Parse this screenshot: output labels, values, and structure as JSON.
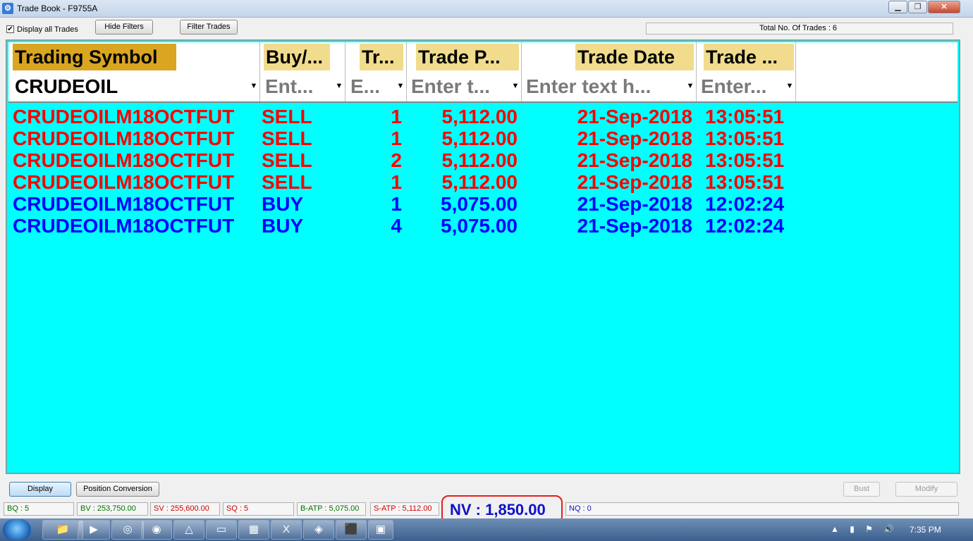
{
  "window": {
    "title": "Trade Book - F9755A",
    "minimize_glyph": "▁",
    "maximize_glyph": "❐",
    "close_glyph": "✕"
  },
  "toolbar": {
    "display_all_checked": true,
    "display_all_label": "Display all Trades",
    "hide_filters_label": "Hide Filters",
    "filter_trades_label": "Filter Trades",
    "total_trades_label": "Total No. Of Trades : 6"
  },
  "grid": {
    "background_color": "#00ffff",
    "columns": [
      {
        "header": "Trading Symbol",
        "filter_value": "CRUDEOIL",
        "filter_is_placeholder": false
      },
      {
        "header": "Buy/...",
        "filter_value": "Ent...",
        "filter_is_placeholder": true
      },
      {
        "header": "Tr...",
        "filter_value": "E...",
        "filter_is_placeholder": true
      },
      {
        "header": "Trade P...",
        "filter_value": "Enter t...",
        "filter_is_placeholder": true
      },
      {
        "header": "Trade Date",
        "filter_value": "Enter text h...",
        "filter_is_placeholder": true
      },
      {
        "header": "Trade ...",
        "filter_value": "Enter...",
        "filter_is_placeholder": true
      }
    ],
    "rows": [
      {
        "symbol": "CRUDEOILM18OCTFUT",
        "side": "SELL",
        "qty": "1",
        "price": "5,112.00",
        "date": "21-Sep-2018",
        "time": "13:05:51",
        "color": "#ff0000"
      },
      {
        "symbol": "CRUDEOILM18OCTFUT",
        "side": "SELL",
        "qty": "1",
        "price": "5,112.00",
        "date": "21-Sep-2018",
        "time": "13:05:51",
        "color": "#ff0000"
      },
      {
        "symbol": "CRUDEOILM18OCTFUT",
        "side": "SELL",
        "qty": "2",
        "price": "5,112.00",
        "date": "21-Sep-2018",
        "time": "13:05:51",
        "color": "#ff0000"
      },
      {
        "symbol": "CRUDEOILM18OCTFUT",
        "side": "SELL",
        "qty": "1",
        "price": "5,112.00",
        "date": "21-Sep-2018",
        "time": "13:05:51",
        "color": "#ff0000"
      },
      {
        "symbol": "CRUDEOILM18OCTFUT",
        "side": "BUY",
        "qty": "1",
        "price": "5,075.00",
        "date": "21-Sep-2018",
        "time": "12:02:24",
        "color": "#0000ff"
      },
      {
        "symbol": "CRUDEOILM18OCTFUT",
        "side": "BUY",
        "qty": "4",
        "price": "5,075.00",
        "date": "21-Sep-2018",
        "time": "12:02:24",
        "color": "#0000ff"
      }
    ]
  },
  "actions": {
    "display_label": "Display",
    "position_conversion_label": "Position Conversion",
    "bust_label": "Bust",
    "modify_label": "Modify"
  },
  "status": {
    "bq": "BQ : 5",
    "bv": "BV : 253,750.00",
    "sv": "SV : 255,600.00",
    "sq": "SQ : 5",
    "batp": "B-ATP : 5,075.00",
    "satp": "S-ATP : 5,112.00",
    "nv": "NV : 1,850.00",
    "nq": "NQ : 0",
    "buy_color": "#007000",
    "sell_color": "#d00000",
    "net_color": "#1010c8"
  },
  "taskbar": {
    "items": [
      "explorer-icon",
      "media-player-icon",
      "lifebuoy-icon",
      "chrome-icon",
      "triangle-app-icon",
      "window-app-icon",
      "calculator-icon",
      "excel-icon",
      "chart-app-icon",
      "pdf-icon",
      "active-window-icon"
    ],
    "tray_icons": "▲ ▮ ⚑ 🔊",
    "clock": "7:35 PM"
  }
}
